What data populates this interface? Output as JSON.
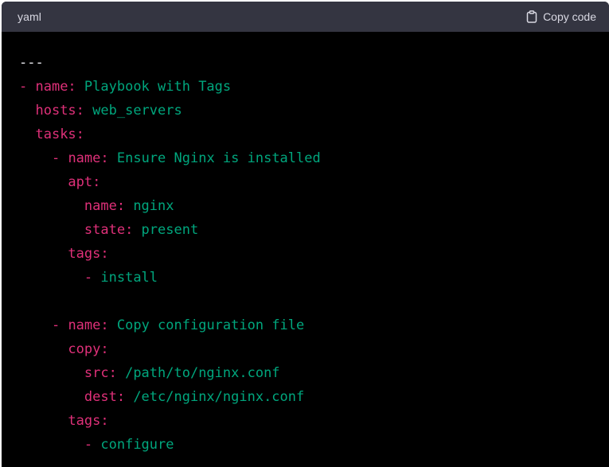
{
  "header": {
    "language": "yaml",
    "copy_label": "Copy code",
    "copy_icon": "clipboard-icon"
  },
  "colors": {
    "background": "#000000",
    "header_bg": "#343541",
    "key": "#df3079",
    "value": "#00a67d",
    "plain": "#ececf1"
  },
  "code": {
    "lines": [
      [
        {
          "t": "doc",
          "s": "---"
        }
      ],
      [
        {
          "t": "dash",
          "s": "- "
        },
        {
          "t": "key",
          "s": "name:"
        },
        {
          "t": "val",
          "s": " Playbook with Tags"
        }
      ],
      [
        {
          "t": "sp",
          "s": "  "
        },
        {
          "t": "key",
          "s": "hosts:"
        },
        {
          "t": "val",
          "s": " web_servers"
        }
      ],
      [
        {
          "t": "sp",
          "s": "  "
        },
        {
          "t": "key",
          "s": "tasks:"
        }
      ],
      [
        {
          "t": "sp",
          "s": "    "
        },
        {
          "t": "dash",
          "s": "- "
        },
        {
          "t": "key",
          "s": "name:"
        },
        {
          "t": "val",
          "s": " Ensure Nginx is installed"
        }
      ],
      [
        {
          "t": "sp",
          "s": "      "
        },
        {
          "t": "key",
          "s": "apt:"
        }
      ],
      [
        {
          "t": "sp",
          "s": "        "
        },
        {
          "t": "key",
          "s": "name:"
        },
        {
          "t": "val",
          "s": " nginx"
        }
      ],
      [
        {
          "t": "sp",
          "s": "        "
        },
        {
          "t": "key",
          "s": "state:"
        },
        {
          "t": "val",
          "s": " present"
        }
      ],
      [
        {
          "t": "sp",
          "s": "      "
        },
        {
          "t": "key",
          "s": "tags:"
        }
      ],
      [
        {
          "t": "sp",
          "s": "        "
        },
        {
          "t": "dash",
          "s": "- "
        },
        {
          "t": "val",
          "s": "install"
        }
      ],
      [],
      [
        {
          "t": "sp",
          "s": "    "
        },
        {
          "t": "dash",
          "s": "- "
        },
        {
          "t": "key",
          "s": "name:"
        },
        {
          "t": "val",
          "s": " Copy configuration file"
        }
      ],
      [
        {
          "t": "sp",
          "s": "      "
        },
        {
          "t": "key",
          "s": "copy:"
        }
      ],
      [
        {
          "t": "sp",
          "s": "        "
        },
        {
          "t": "key",
          "s": "src:"
        },
        {
          "t": "val",
          "s": " /path/to/nginx.conf"
        }
      ],
      [
        {
          "t": "sp",
          "s": "        "
        },
        {
          "t": "key",
          "s": "dest:"
        },
        {
          "t": "val",
          "s": " /etc/nginx/nginx.conf"
        }
      ],
      [
        {
          "t": "sp",
          "s": "      "
        },
        {
          "t": "key",
          "s": "tags:"
        }
      ],
      [
        {
          "t": "sp",
          "s": "        "
        },
        {
          "t": "dash",
          "s": "- "
        },
        {
          "t": "val",
          "s": "configure"
        }
      ]
    ]
  }
}
